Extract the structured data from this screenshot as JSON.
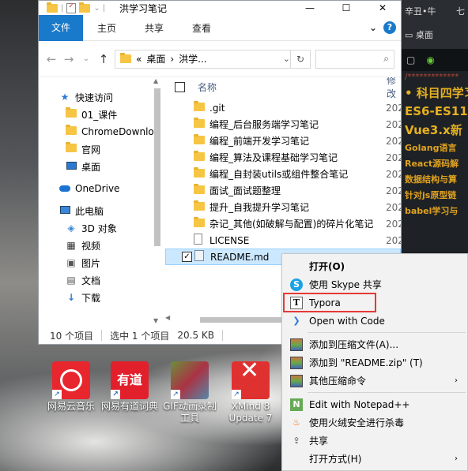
{
  "window": {
    "title": "洪学习笔记",
    "min": "—",
    "max": "☐",
    "close": "✕"
  },
  "ribbon": {
    "tabs": [
      "文件",
      "主页",
      "共享",
      "查看"
    ],
    "expand": "⌄",
    "help": "?"
  },
  "address": {
    "back": "←",
    "forward": "→",
    "dropdown": "⌄",
    "up": "↑",
    "path_prefix": "«",
    "crumb1": "桌面",
    "crumb_sep": "›",
    "crumb2": "洪学...",
    "chevron": "⌄",
    "refresh": "↻",
    "search_icon": "⌕"
  },
  "nav": {
    "items": [
      {
        "label": "快速访问",
        "icon": "star-icon"
      },
      {
        "label": "01_课件",
        "icon": "folder-icon"
      },
      {
        "label": "ChromeDownlo",
        "icon": "folder-icon"
      },
      {
        "label": "官网",
        "icon": "folder-icon"
      },
      {
        "label": "桌面",
        "icon": "desktop-icon"
      },
      {
        "label": "OneDrive",
        "icon": "cloud-icon"
      },
      {
        "label": "此电脑",
        "icon": "pc-icon"
      },
      {
        "label": "3D 对象",
        "icon": "cube-icon"
      },
      {
        "label": "视频",
        "icon": "video-icon"
      },
      {
        "label": "图片",
        "icon": "picture-icon"
      },
      {
        "label": "文档",
        "icon": "document-icon"
      },
      {
        "label": "下载",
        "icon": "download-icon"
      }
    ]
  },
  "files": {
    "header_name": "名称",
    "header_modified": "修改",
    "sort_arrow": "^",
    "rows": [
      {
        "name": ".git",
        "type": "folder",
        "year": "202"
      },
      {
        "name": "编程_后台服务端学习笔记",
        "type": "folder",
        "year": "202"
      },
      {
        "name": "编程_前端开发学习笔记",
        "type": "folder",
        "year": "202"
      },
      {
        "name": "编程_算法及课程基础学习笔记",
        "type": "folder",
        "year": "202"
      },
      {
        "name": "编程_自封装utils或组件整合笔记",
        "type": "folder",
        "year": "202"
      },
      {
        "name": "面试_面试题整理",
        "type": "folder",
        "year": "202"
      },
      {
        "name": "提升_自我提升学习笔记",
        "type": "folder",
        "year": "202"
      },
      {
        "name": "杂记_其他(如破解与配置)的碎片化笔记",
        "type": "folder",
        "year": "202"
      },
      {
        "name": "LICENSE",
        "type": "file",
        "year": "202"
      },
      {
        "name": "README.md",
        "type": "md",
        "year": ""
      }
    ],
    "selected_check": "✓"
  },
  "status": {
    "count": "10 个项目",
    "selected": "选中 1 个项目",
    "size": "20.5 KB"
  },
  "desktop_icons": [
    {
      "label": "网易云音乐",
      "icon": "netease-music-icon"
    },
    {
      "label": "网易有道词典",
      "icon": "youdao-dict-icon",
      "glyph": "有道"
    },
    {
      "label": "GIF动画录制工具",
      "icon": "gif-recorder-icon"
    },
    {
      "label": "XMind 8 Update 7",
      "icon": "xmind-icon"
    }
  ],
  "shortcut_arrow": "↗",
  "right_panel": {
    "top_left": "辛丑•牛",
    "top_right": "七",
    "desktop_label": "桌面",
    "lines": [
      {
        "text": "/*************",
        "style": "dash"
      },
      {
        "text": "• 科目四学习",
        "style": "big"
      },
      {
        "text": "ES6-ES11",
        "style": "big"
      },
      {
        "text": "Vue3.x新",
        "style": "big"
      },
      {
        "text": "Golang语言",
        "style": "small"
      },
      {
        "text": "React源码解",
        "style": "small"
      },
      {
        "text": "数据结构与算",
        "style": "small"
      },
      {
        "text": "针对js原型链",
        "style": "small"
      },
      {
        "text": "babel学习与",
        "style": "small"
      }
    ]
  },
  "context_menu": {
    "items": [
      {
        "label": "打开(O)",
        "icon": "",
        "bold": true
      },
      {
        "label": "使用 Skype 共享",
        "icon": "skype-icon"
      },
      {
        "label": "Typora",
        "icon": "typora-icon",
        "highlight": true
      },
      {
        "label": "Open with Code",
        "icon": "vscode-icon"
      },
      {
        "sep": true
      },
      {
        "label": "添加到压缩文件(A)...",
        "icon": "winrar-icon"
      },
      {
        "label": "添加到 \"README.zip\" (T)",
        "icon": "winrar-icon"
      },
      {
        "label": "其他压缩命令",
        "icon": "winrar-icon",
        "submenu": true
      },
      {
        "sep": true
      },
      {
        "label": "Edit with Notepad++",
        "icon": "notepadpp-icon"
      },
      {
        "label": "使用火绒安全进行杀毒",
        "icon": "huorong-icon"
      },
      {
        "label": "共享",
        "icon": "share-icon"
      },
      {
        "label": "打开方式(H)",
        "icon": "",
        "submenu": true
      }
    ],
    "submenu_arrow": "›"
  }
}
